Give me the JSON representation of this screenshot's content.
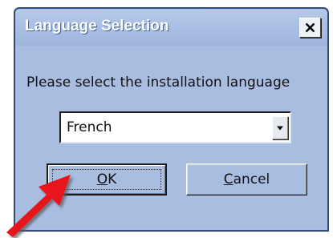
{
  "window": {
    "title": "Language Selection",
    "close_icon": "close-icon"
  },
  "prompt": "Please select the installation language",
  "language_select": {
    "value": "French",
    "dropdown_icon": "chevron-down-icon"
  },
  "buttons": {
    "ok": {
      "mnemonic": "O",
      "rest": "K"
    },
    "cancel": {
      "mnemonic": "C",
      "rest": "ancel"
    }
  },
  "annotation": {
    "arrow_color": "#e8141b",
    "points_to": "OK"
  },
  "colors": {
    "dialog_bg": "#a8bde0",
    "title_text": "#ffffff"
  }
}
